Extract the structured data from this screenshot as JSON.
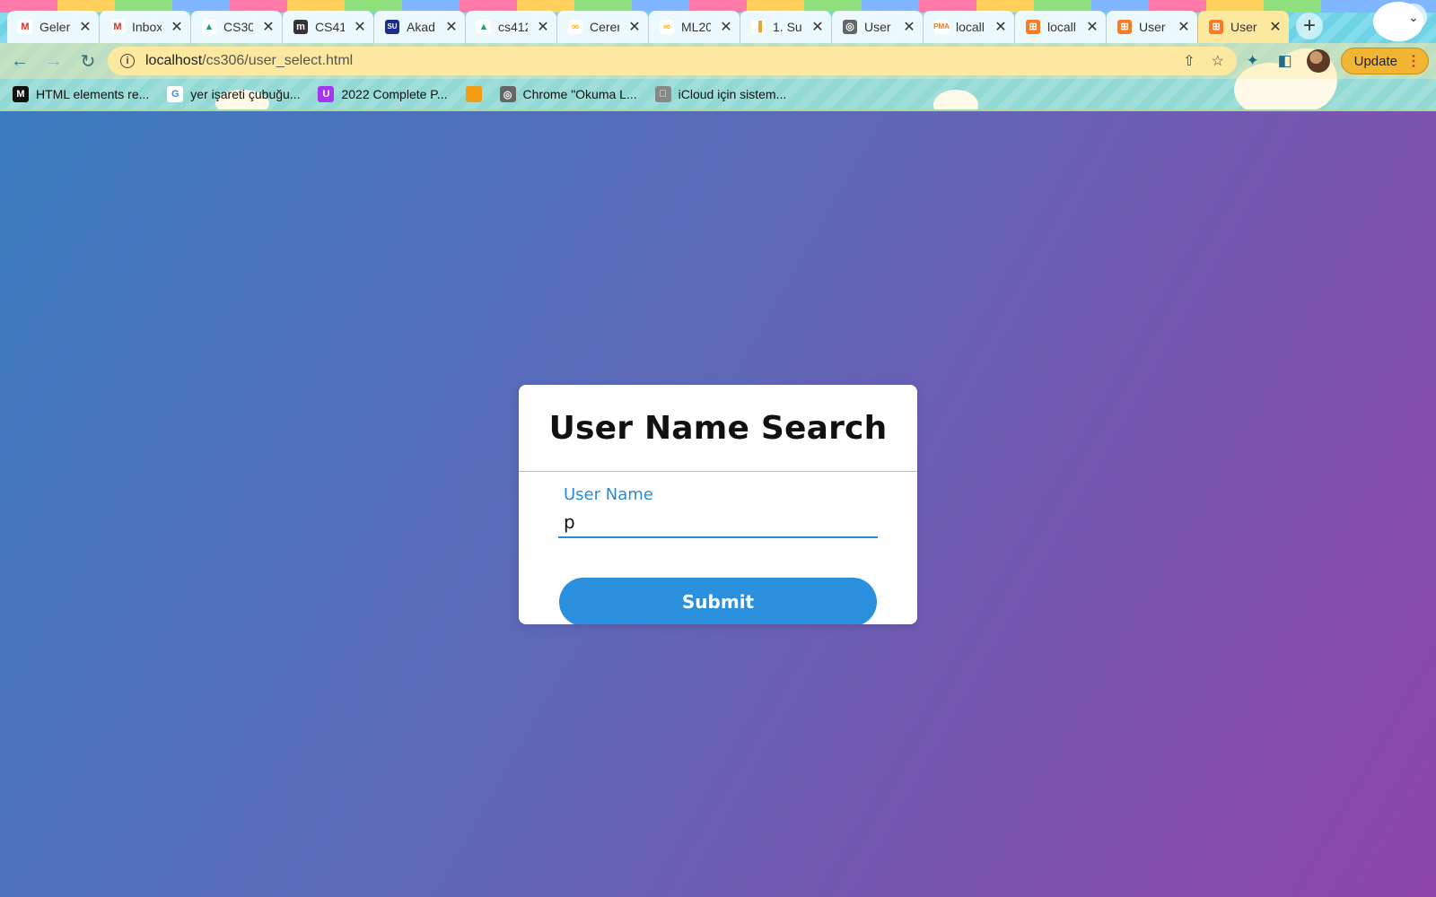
{
  "browser": {
    "tabs": [
      {
        "title": "Geler",
        "icon": "gmail-icon",
        "active": false
      },
      {
        "title": "Inbox",
        "icon": "gmail-icon",
        "active": false
      },
      {
        "title": "CS30",
        "icon": "google-drive-icon",
        "active": false
      },
      {
        "title": "CS41",
        "icon": "m-logo-icon",
        "active": false
      },
      {
        "title": "Akad",
        "icon": "su-logo-icon",
        "active": false
      },
      {
        "title": "cs412",
        "icon": "google-drive-icon",
        "active": false
      },
      {
        "title": "Cerer",
        "icon": "colab-icon",
        "active": false
      },
      {
        "title": "ML20",
        "icon": "colab-icon",
        "active": false
      },
      {
        "title": "1. Su",
        "icon": "chart-bars-icon",
        "active": false
      },
      {
        "title": "User",
        "icon": "globe-icon",
        "active": false
      },
      {
        "title": "locall",
        "icon": "phpmyadmin-icon",
        "active": false
      },
      {
        "title": "locall",
        "icon": "xampp-icon",
        "active": false
      },
      {
        "title": "User",
        "icon": "xampp-icon",
        "active": false
      },
      {
        "title": "User",
        "icon": "xampp-icon",
        "active": true
      }
    ],
    "address": {
      "host": "localhost",
      "path": "/cs306/user_select.html"
    },
    "update_label": "Update",
    "bookmarks": [
      {
        "label": "HTML elements re...",
        "icon": "mdn-icon"
      },
      {
        "label": "yer işareti çubuğu...",
        "icon": "google-icon"
      },
      {
        "label": "2022 Complete P...",
        "icon": "udemy-icon"
      },
      {
        "label": "",
        "icon": "folder-icon"
      },
      {
        "label": "Chrome \"Okuma L...",
        "icon": "globe-icon"
      },
      {
        "label": "iCloud için sistem...",
        "icon": "apple-icon"
      }
    ]
  },
  "form": {
    "title": "User Name Search",
    "field_label": "User Name",
    "field_value": "p",
    "submit_label": "Submit"
  },
  "colors": {
    "accent": "#2a8fdc",
    "label": "#2b8ad8",
    "background_start": "#3b7bbf",
    "background_end": "#8d44ac"
  }
}
